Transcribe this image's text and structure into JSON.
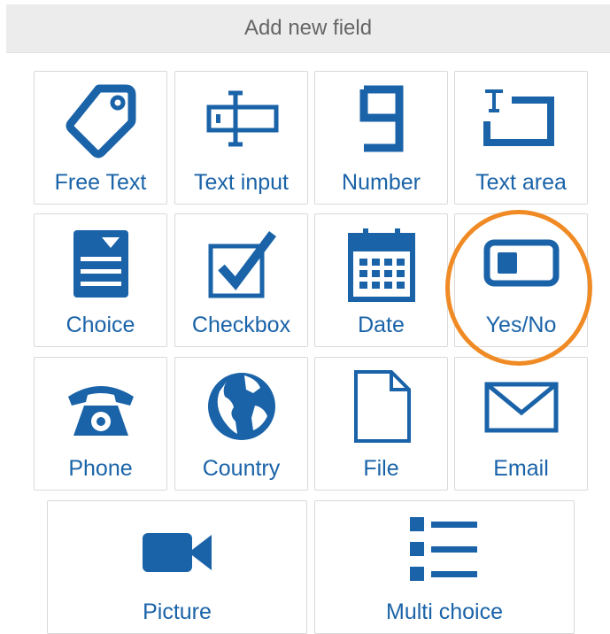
{
  "header": {
    "title": "Add new field"
  },
  "fields": {
    "free_text": "Free Text",
    "text_input": "Text input",
    "number": "Number",
    "text_area": "Text area",
    "choice": "Choice",
    "checkbox": "Checkbox",
    "date": "Date",
    "yes_no": "Yes/No",
    "phone": "Phone",
    "country": "Country",
    "file": "File",
    "email": "Email",
    "picture": "Picture",
    "multi_choice": "Multi choice"
  },
  "icons": {
    "free_text": "tag-icon",
    "text_input": "text-input-icon",
    "number": "number-icon",
    "text_area": "text-area-icon",
    "choice": "choice-icon",
    "checkbox": "checkbox-icon",
    "date": "calendar-icon",
    "yes_no": "toggle-icon",
    "phone": "phone-icon",
    "country": "globe-icon",
    "file": "file-icon",
    "email": "envelope-icon",
    "picture": "video-camera-icon",
    "multi_choice": "list-icon"
  },
  "highlight": {
    "target": "yes_no",
    "color": "#f08a24"
  },
  "colors": {
    "icon": "#1a63a8",
    "label": "#1a63a8",
    "header_bg": "#ececec",
    "header_text": "#666666"
  }
}
